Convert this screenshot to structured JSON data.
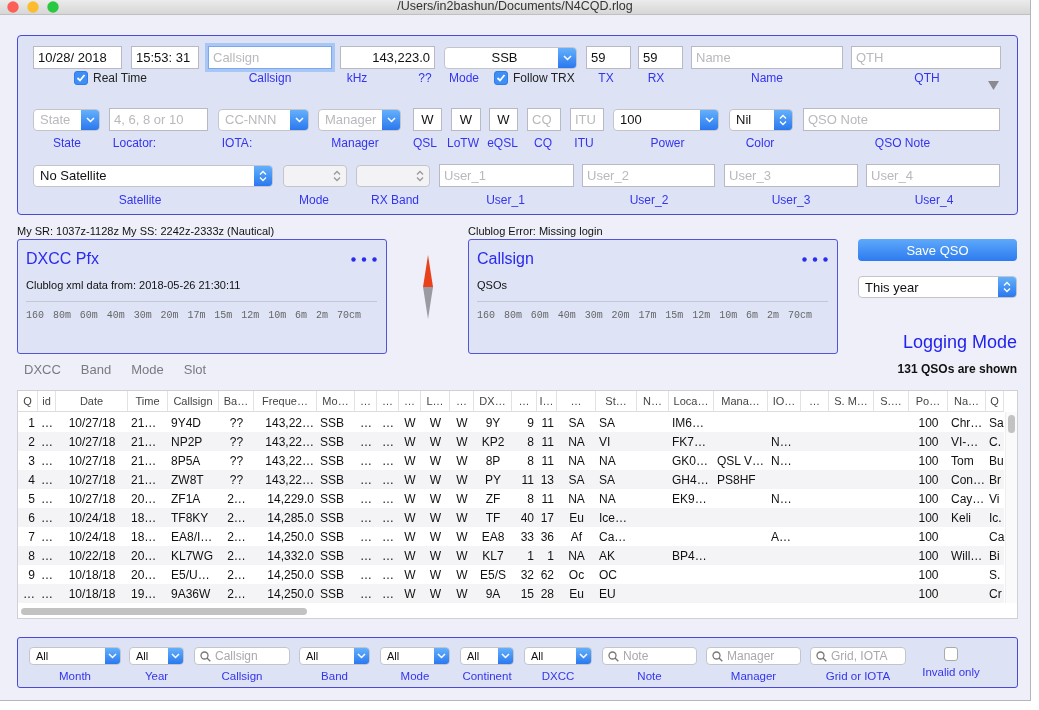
{
  "window": {
    "title": "/Users/in2bashun/Documents/N4CQD.rlog"
  },
  "entry_form": {
    "rows": [
      {
        "fields": [
          {
            "kind": "text",
            "value": "10/28/ 2018"
          },
          {
            "kind": "text",
            "value": "15:53: 31"
          },
          {
            "kind": "text",
            "placeholder": "Callsign",
            "focused": true
          },
          {
            "kind": "text",
            "value": "143,223.0"
          },
          {
            "kind": "select",
            "value": "SSB"
          },
          {
            "kind": "text",
            "value": "59"
          },
          {
            "kind": "text",
            "value": "59"
          },
          {
            "kind": "text",
            "placeholder": "Name"
          },
          {
            "kind": "text",
            "placeholder": "QTH"
          }
        ],
        "labels": [
          {
            "kind": "checkbox",
            "text": "Real Time",
            "checked": true
          },
          {
            "kind": "label",
            "text": "Callsign"
          },
          {
            "kind": "label",
            "text": "kHz"
          },
          {
            "kind": "label",
            "text": "??"
          },
          {
            "kind": "label",
            "text": "Mode"
          },
          {
            "kind": "checkbox",
            "text": "Follow TRX",
            "checked": true
          },
          {
            "kind": "label",
            "text": "TX"
          },
          {
            "kind": "label",
            "text": "RX"
          },
          {
            "kind": "label",
            "text": "Name"
          },
          {
            "kind": "label",
            "text": "QTH"
          }
        ]
      },
      {
        "fields": [
          {
            "kind": "select",
            "placeholder": "State"
          },
          {
            "kind": "text",
            "placeholder": "4, 6, 8 or 10"
          },
          {
            "kind": "select",
            "placeholder": "CC-NNN"
          },
          {
            "kind": "select",
            "placeholder": "Manager"
          },
          {
            "kind": "text",
            "value": "W"
          },
          {
            "kind": "text",
            "value": "W"
          },
          {
            "kind": "text",
            "value": "W"
          },
          {
            "kind": "text",
            "placeholder": "CQ"
          },
          {
            "kind": "text",
            "placeholder": "ITU"
          },
          {
            "kind": "select",
            "value": "100"
          },
          {
            "kind": "stepper",
            "value": "Nil",
            "disabled": false
          },
          {
            "kind": "text",
            "placeholder": "QSO Note"
          }
        ],
        "labels": [
          {
            "kind": "label",
            "text": "State"
          },
          {
            "kind": "label",
            "text": "Locator:"
          },
          {
            "kind": "label",
            "text": "IOTA:"
          },
          {
            "kind": "label",
            "text": "Manager"
          },
          {
            "kind": "label",
            "text": "QSL"
          },
          {
            "kind": "label",
            "text": "LoTW"
          },
          {
            "kind": "label",
            "text": "eQSL"
          },
          {
            "kind": "label",
            "text": "CQ"
          },
          {
            "kind": "label",
            "text": "ITU"
          },
          {
            "kind": "label",
            "text": "Power"
          },
          {
            "kind": "label",
            "text": "Color"
          },
          {
            "kind": "label",
            "text": "QSO Note"
          }
        ]
      },
      {
        "fields": [
          {
            "kind": "stepper",
            "value": "No Satellite",
            "disabled": false
          },
          {
            "kind": "stepper",
            "disabled": true
          },
          {
            "kind": "stepper",
            "disabled": true
          },
          {
            "kind": "text",
            "placeholder": "User_1"
          },
          {
            "kind": "text",
            "placeholder": "User_2"
          },
          {
            "kind": "text",
            "placeholder": "User_3"
          },
          {
            "kind": "text",
            "placeholder": "User_4"
          }
        ],
        "labels": [
          {
            "kind": "label",
            "text": "Satellite"
          },
          {
            "kind": "label",
            "text": "Mode"
          },
          {
            "kind": "label",
            "text": "RX Band"
          },
          {
            "kind": "label",
            "text": "User_1"
          },
          {
            "kind": "label",
            "text": "User_2"
          },
          {
            "kind": "label",
            "text": "User_3"
          },
          {
            "kind": "label",
            "text": "User_4"
          }
        ]
      }
    ]
  },
  "sun_times": "My SR: 1037z-1128z  My SS: 2242z-2333z (Nautical)",
  "clublog_status": "Clublog Error: Missing login",
  "cards": [
    {
      "title": "DXCC Pfx",
      "info": "Clublog xml data from: 2018-05-26 21:30:11",
      "bands": [
        "160",
        "80m",
        "60m",
        "40m",
        "30m",
        "20m",
        "17m",
        "15m",
        "12m",
        "10m",
        "6m",
        "2m",
        "70cm"
      ]
    },
    {
      "title": "Callsign",
      "info": "QSOs",
      "bands": [
        "160",
        "80m",
        "60m",
        "40m",
        "30m",
        "20m",
        "17m",
        "15m",
        "12m",
        "10m",
        "6m",
        "2m",
        "70cm"
      ]
    }
  ],
  "view_tabs": [
    "DXCC",
    "Band",
    "Mode",
    "Slot"
  ],
  "save_button": "Save QSO",
  "period_select": {
    "value": "This year"
  },
  "mode_title": "Logging Mode",
  "qso_count": "131 QSOs are shown",
  "table": {
    "columns": [
      "Q",
      "id",
      "Date",
      "Time",
      "Callsign",
      "Ba…",
      "Freque…",
      "Mo…",
      "…",
      "…",
      "…",
      "L…",
      "…",
      "DX…",
      "…",
      "I…",
      "…",
      "St…",
      "N…",
      "Loca…",
      "Mana…",
      "IO…",
      "…",
      "S. M…",
      "S.…",
      "Po…",
      "Na…",
      "Q"
    ],
    "rows": [
      [
        "1",
        "…",
        "10/27/18",
        "21…",
        "9Y4D",
        "??",
        "143,22…",
        "SSB",
        "…",
        "…",
        "W",
        "W",
        "W",
        "9Y",
        "9",
        "11",
        "SA",
        "SA",
        null,
        "IM6…",
        null,
        null,
        null,
        null,
        null,
        "100",
        "Chr…",
        "Sa"
      ],
      [
        "2",
        "…",
        "10/27/18",
        "21…",
        "NP2P",
        "??",
        "143,22…",
        "SSB",
        "…",
        "…",
        "W",
        "W",
        "W",
        "KP2",
        "8",
        "11",
        "NA",
        "VI",
        null,
        "FK7…",
        null,
        "N…",
        null,
        null,
        null,
        "100",
        "VI-…",
        "C."
      ],
      [
        "3",
        "…",
        "10/27/18",
        "21…",
        "8P5A",
        "??",
        "143,22…",
        "SSB",
        "…",
        "…",
        "W",
        "W",
        "W",
        "8P",
        "8",
        "11",
        "NA",
        "NA",
        null,
        "GK0…",
        "QSL V…",
        "N…",
        null,
        null,
        null,
        "100",
        "Tom",
        "Bu"
      ],
      [
        "4",
        "…",
        "10/27/18",
        "21…",
        "ZW8T",
        "??",
        "143,22…",
        "SSB",
        "…",
        "…",
        "W",
        "W",
        "W",
        "PY",
        "11",
        "13",
        "SA",
        "SA",
        null,
        "GH4…",
        "PS8HF",
        null,
        null,
        null,
        null,
        "100",
        "Con…",
        "Br"
      ],
      [
        "5",
        "…",
        "10/27/18",
        "20…",
        "ZF1A",
        "2…",
        "14,229.0",
        "SSB",
        "…",
        "…",
        "W",
        "W",
        "W",
        "ZF",
        "8",
        "11",
        "NA",
        "NA",
        null,
        "EK9…",
        null,
        "N…",
        null,
        null,
        null,
        "100",
        "Cay…",
        "Vi"
      ],
      [
        "6",
        "…",
        "10/24/18",
        "18…",
        "TF8KY",
        "2…",
        "14,285.0",
        "SSB",
        "…",
        "…",
        "W",
        "W",
        "W",
        "TF",
        "40",
        "17",
        "Eu",
        "Ice…",
        null,
        null,
        null,
        null,
        null,
        null,
        null,
        "100",
        "Keli",
        "Ic."
      ],
      [
        "7",
        "…",
        "10/24/18",
        "18…",
        "EA8/I…",
        "2…",
        "14,250.0",
        "SSB",
        "…",
        "…",
        "W",
        "W",
        "W",
        "EA8",
        "33",
        "36",
        "Af",
        "Ca…",
        null,
        null,
        null,
        "A…",
        null,
        null,
        null,
        "100",
        null,
        "Ca"
      ],
      [
        "8",
        "…",
        "10/22/18",
        "20…",
        "KL7WG",
        "2…",
        "14,332.0",
        "SSB",
        "…",
        "…",
        "W",
        "W",
        "W",
        "KL7",
        "1",
        "1",
        "NA",
        "AK",
        null,
        "BP4…",
        null,
        null,
        null,
        null,
        null,
        "100",
        "Will…",
        "Bi"
      ],
      [
        "9",
        "…",
        "10/18/18",
        "20…",
        "E5/U…",
        "2…",
        "14,250.0",
        "SSB",
        "…",
        "…",
        "W",
        "W",
        "W",
        "E5/S",
        "32",
        "62",
        "Oc",
        "OC",
        null,
        null,
        null,
        null,
        null,
        null,
        null,
        "100",
        null,
        "S."
      ],
      [
        "…",
        "…",
        "10/18/18",
        "19…",
        "9A36W",
        "2…",
        "14,250.0",
        "SSB",
        "…",
        "…",
        "W",
        "W",
        "W",
        "9A",
        "15",
        "28",
        "Eu",
        "EU",
        null,
        null,
        null,
        null,
        null,
        null,
        null,
        "100",
        null,
        "Cr"
      ]
    ]
  },
  "filters": [
    {
      "kind": "select",
      "value": "All",
      "label": "Month"
    },
    {
      "kind": "select",
      "value": "All",
      "label": "Year"
    },
    {
      "kind": "search",
      "placeholder": "Callsign",
      "label": "Callsign"
    },
    {
      "kind": "select",
      "value": "All",
      "label": "Band"
    },
    {
      "kind": "select",
      "value": "All",
      "label": "Mode"
    },
    {
      "kind": "select",
      "value": "All",
      "label": "Continent"
    },
    {
      "kind": "select",
      "value": "All",
      "label": "DXCC"
    },
    {
      "kind": "search",
      "placeholder": "Note",
      "label": "Note"
    },
    {
      "kind": "search",
      "placeholder": "Manager",
      "label": "Manager"
    },
    {
      "kind": "search",
      "placeholder": "Grid, IOTA",
      "label": "Grid or IOTA"
    },
    {
      "kind": "checkbox",
      "checked": false,
      "label": "Invalid only"
    }
  ]
}
